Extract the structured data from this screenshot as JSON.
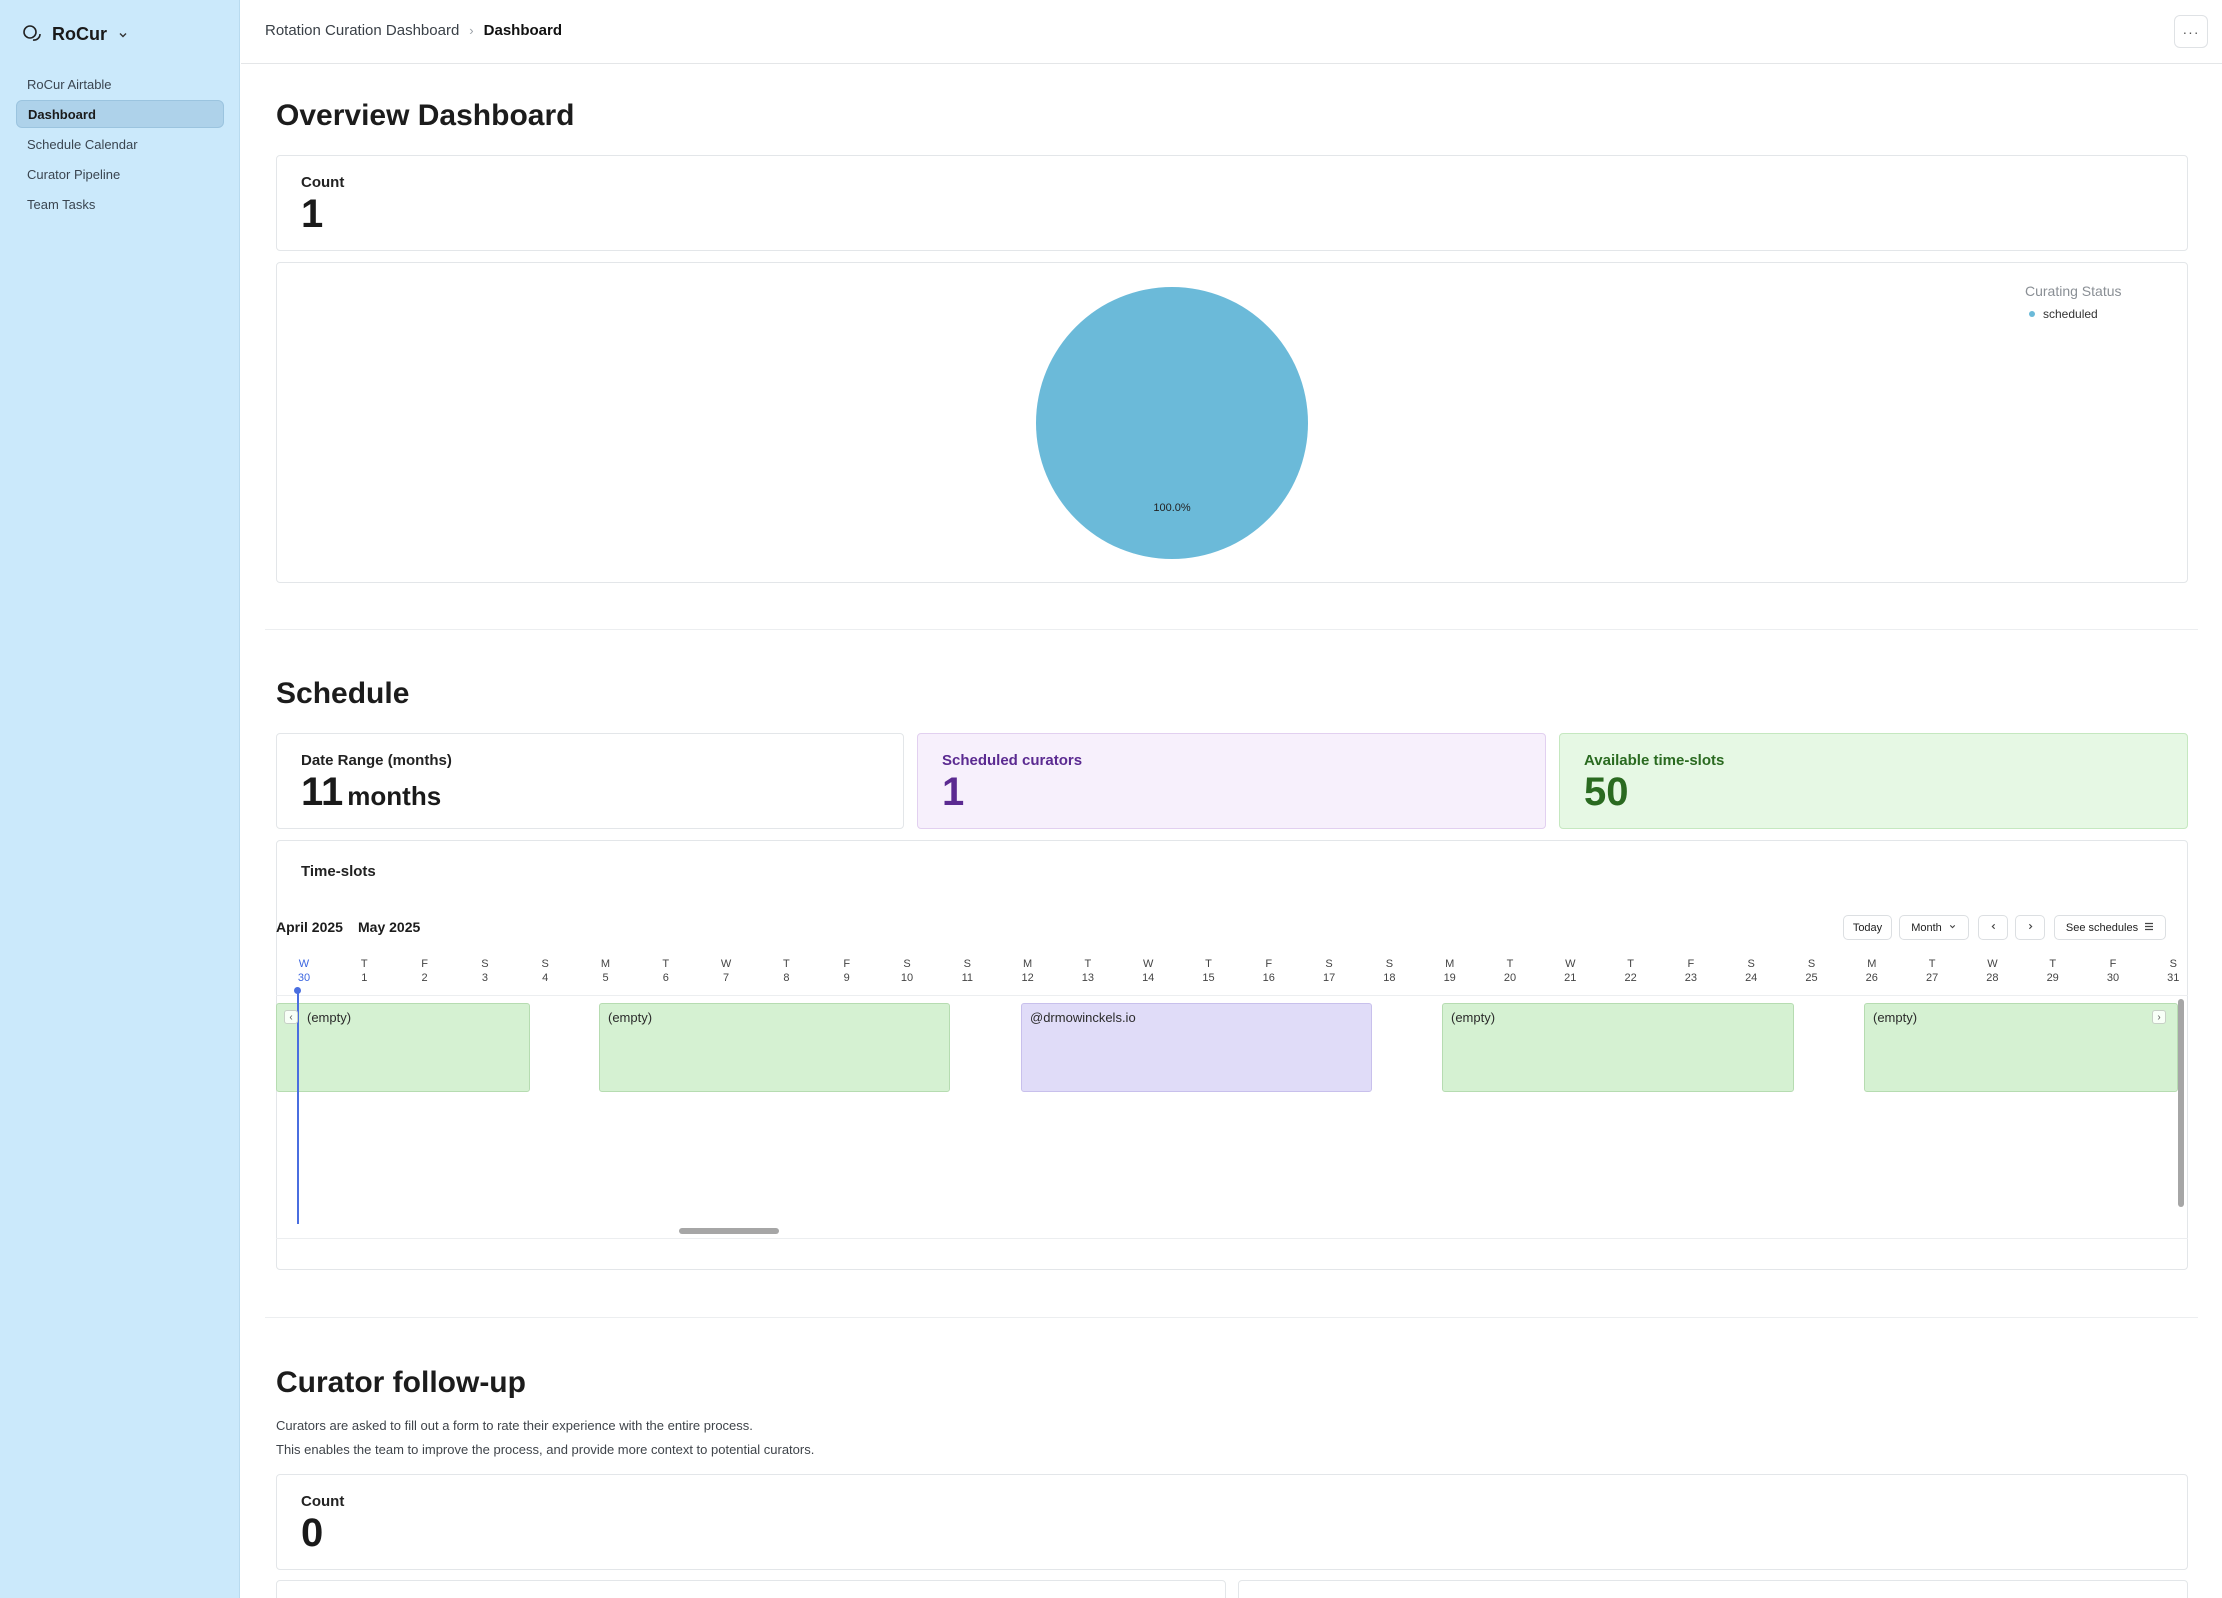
{
  "sidebar": {
    "app_name": "RoCur",
    "logo_icon": "chat-bubbles-icon",
    "items": [
      {
        "label": "RoCur Airtable",
        "active": false
      },
      {
        "label": "Dashboard",
        "active": true
      },
      {
        "label": "Schedule Calendar",
        "active": false
      },
      {
        "label": "Curator Pipeline",
        "active": false
      },
      {
        "label": "Team Tasks",
        "active": false
      }
    ]
  },
  "header": {
    "breadcrumb_parent": "Rotation Curation Dashboard",
    "breadcrumb_current": "Dashboard",
    "more_label": "···"
  },
  "overview": {
    "title": "Overview Dashboard",
    "count_label": "Count",
    "count_value": "1"
  },
  "chart_data": {
    "type": "pie",
    "legend_title": "Curating Status",
    "legend_position": "top-right",
    "slices": [
      {
        "name": "scheduled",
        "value": 100.0,
        "label": "100.0%",
        "color": "#6bbad9"
      }
    ]
  },
  "schedule": {
    "title": "Schedule",
    "date_range_label": "Date Range (months)",
    "date_range_value": "11",
    "date_range_unit": "months",
    "scheduled_label": "Scheduled curators",
    "scheduled_value": "1",
    "available_label": "Available time-slots",
    "available_value": "50",
    "colors": {
      "scheduled_bg": "#f7f0fc",
      "scheduled_text": "#5b2a91",
      "available_bg": "#e6f8e4",
      "available_text": "#2a6a20"
    }
  },
  "timeslots": {
    "title": "Time-slots",
    "month_current": "April 2025",
    "month_next": "May 2025",
    "today_label": "Today",
    "view_label": "Month",
    "see_schedules_label": "See schedules",
    "days": [
      {
        "l": "W",
        "d": "30"
      },
      {
        "l": "T",
        "d": "1"
      },
      {
        "l": "F",
        "d": "2"
      },
      {
        "l": "S",
        "d": "3"
      },
      {
        "l": "S",
        "d": "4"
      },
      {
        "l": "M",
        "d": "5"
      },
      {
        "l": "T",
        "d": "6"
      },
      {
        "l": "W",
        "d": "7"
      },
      {
        "l": "T",
        "d": "8"
      },
      {
        "l": "F",
        "d": "9"
      },
      {
        "l": "S",
        "d": "10"
      },
      {
        "l": "S",
        "d": "11"
      },
      {
        "l": "M",
        "d": "12"
      },
      {
        "l": "T",
        "d": "13"
      },
      {
        "l": "W",
        "d": "14"
      },
      {
        "l": "T",
        "d": "15"
      },
      {
        "l": "F",
        "d": "16"
      },
      {
        "l": "S",
        "d": "17"
      },
      {
        "l": "S",
        "d": "18"
      },
      {
        "l": "M",
        "d": "19"
      },
      {
        "l": "T",
        "d": "20"
      },
      {
        "l": "W",
        "d": "21"
      },
      {
        "l": "T",
        "d": "22"
      },
      {
        "l": "F",
        "d": "23"
      },
      {
        "l": "S",
        "d": "24"
      },
      {
        "l": "S",
        "d": "25"
      },
      {
        "l": "M",
        "d": "26"
      },
      {
        "l": "T",
        "d": "27"
      },
      {
        "l": "W",
        "d": "28"
      },
      {
        "l": "T",
        "d": "29"
      },
      {
        "l": "F",
        "d": "30"
      },
      {
        "l": "S",
        "d": "31"
      }
    ],
    "slots": [
      {
        "label": "(empty)",
        "booked": false
      },
      {
        "label": "(empty)",
        "booked": false
      },
      {
        "label": "@drmowinckels.io",
        "booked": true
      },
      {
        "label": "(empty)",
        "booked": false
      },
      {
        "label": "(empty)",
        "booked": false
      }
    ]
  },
  "followup": {
    "title": "Curator follow-up",
    "desc1": "Curators are asked to fill out a form to rate their experience with the entire process.",
    "desc2": "This enables the team to improve the process, and provide more context to potential curators.",
    "count_label": "Count",
    "count_value": "0"
  }
}
